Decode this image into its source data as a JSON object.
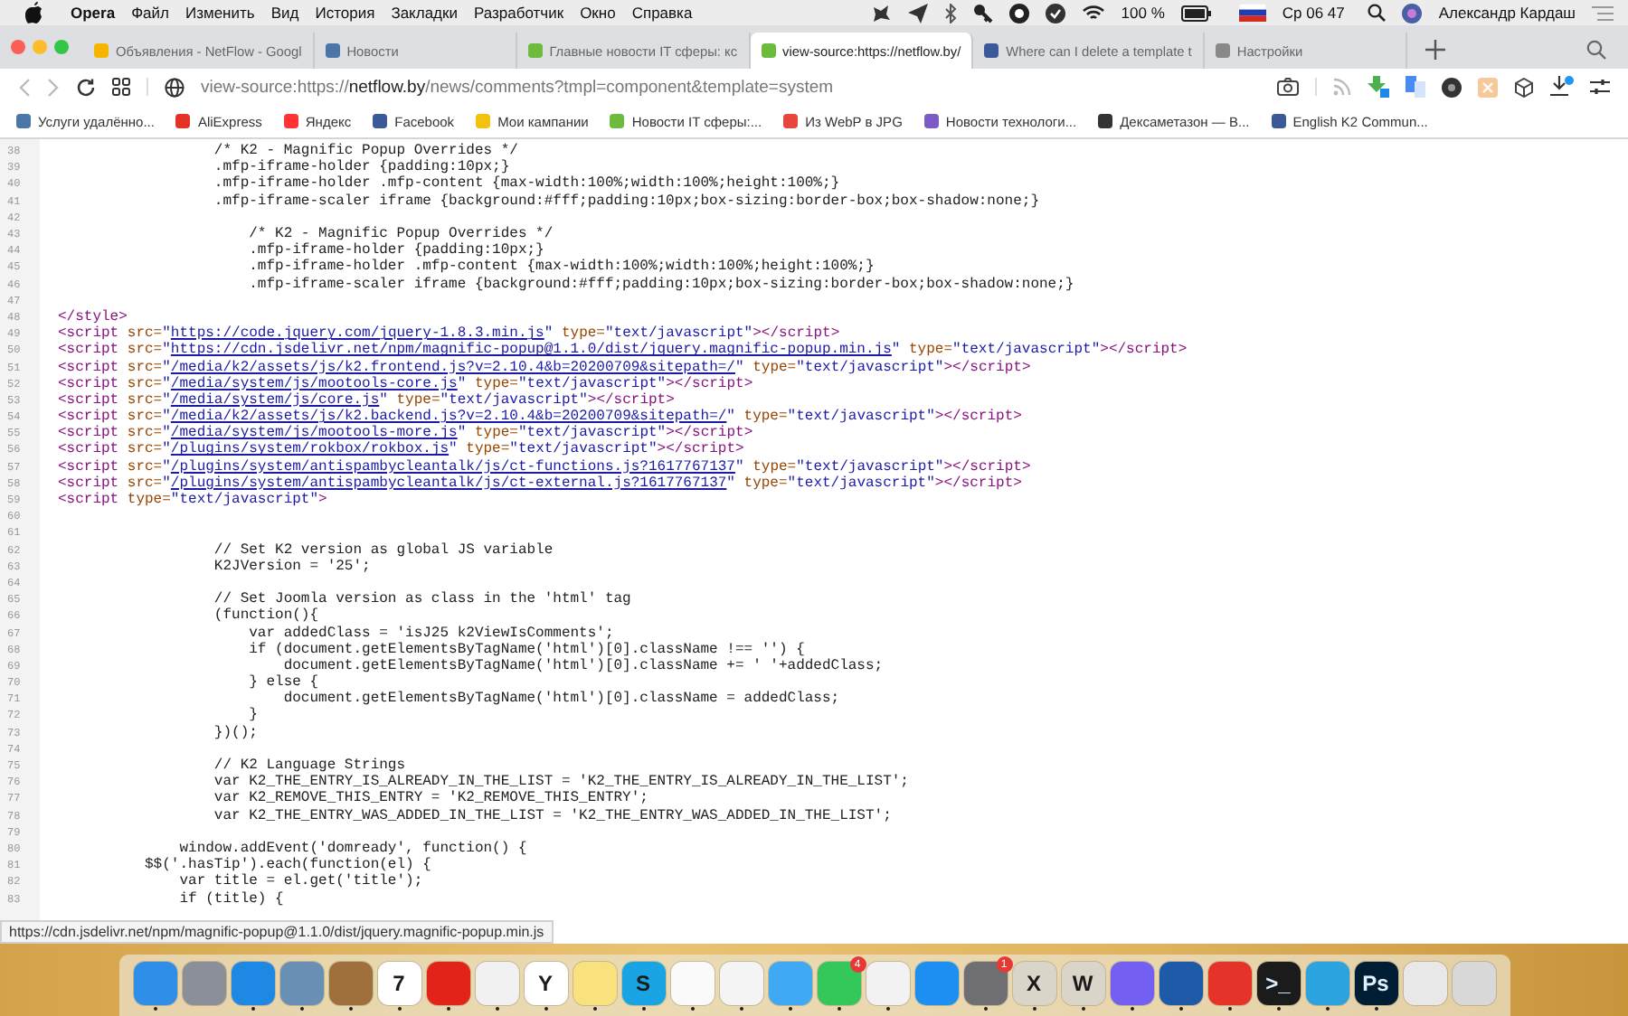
{
  "menu_bar": {
    "app": "Opera",
    "menus": [
      "Файл",
      "Изменить",
      "Вид",
      "История",
      "Закладки",
      "Разработчик",
      "Окно",
      "Справка"
    ],
    "battery": "100 %",
    "clock": "Ср 06 47",
    "user": "Александр Кардаш"
  },
  "tabs": [
    {
      "title": "Объявления - NetFlow - Googl",
      "selected": false,
      "color": "#f4b400"
    },
    {
      "title": "Новости",
      "selected": false,
      "color": "#4a76a8"
    },
    {
      "title": "Главные новости IT сферы: кс",
      "selected": false,
      "color": "#6cbb3c"
    },
    {
      "title": "view-source:https://netflow.by/",
      "selected": true,
      "color": "#6cbb3c"
    },
    {
      "title": "Where can I delete a template t",
      "selected": false,
      "color": "#3b5998"
    },
    {
      "title": "Настройки",
      "selected": false,
      "color": "#888888"
    }
  ],
  "address_bar": {
    "scheme": "view-source:https://",
    "host": "netflow.by",
    "path": "/news/comments?tmpl=component&template=system"
  },
  "bookmarks": [
    {
      "title": "Услуги удалённо...",
      "color": "#4a76a8"
    },
    {
      "title": "AliExpress",
      "color": "#e43225"
    },
    {
      "title": "Яндекс",
      "color": "#ff3333"
    },
    {
      "title": "Facebook",
      "color": "#3b5998"
    },
    {
      "title": "Мои кампании",
      "color": "#f4c20d"
    },
    {
      "title": "Новости IT сферы:...",
      "color": "#6cbb3c"
    },
    {
      "title": "Из WebP в JPG",
      "color": "#e8453c"
    },
    {
      "title": "Новости технологи...",
      "color": "#7b5cc4"
    },
    {
      "title": "Дексаметазон — В...",
      "color": "#333333"
    },
    {
      "title": "English K2 Commun...",
      "color": "#3b5998"
    }
  ],
  "source": {
    "lines": [
      {
        "num": "38",
        "segments": [
          {
            "kind": "plain",
            "text": "                  /* K2 - Magnific Popup Overrides */"
          }
        ]
      },
      {
        "num": "39",
        "segments": [
          {
            "kind": "plain",
            "text": "                  .mfp-iframe-holder {padding:10px;}"
          }
        ]
      },
      {
        "num": "40",
        "segments": [
          {
            "kind": "plain",
            "text": "                  .mfp-iframe-holder .mfp-content {max-width:100%;width:100%;height:100%;}"
          }
        ]
      },
      {
        "num": "41",
        "segments": [
          {
            "kind": "plain",
            "text": "                  .mfp-iframe-scaler iframe {background:#fff;padding:10px;box-sizing:border-box;box-shadow:none;}"
          }
        ]
      },
      {
        "num": "42"
      },
      {
        "num": "43",
        "segments": [
          {
            "kind": "plain",
            "text": "                      /* K2 - Magnific Popup Overrides */"
          }
        ]
      },
      {
        "num": "44",
        "segments": [
          {
            "kind": "plain",
            "text": "                      .mfp-iframe-holder {padding:10px;}"
          }
        ]
      },
      {
        "num": "45",
        "segments": [
          {
            "kind": "plain",
            "text": "                      .mfp-iframe-holder .mfp-content {max-width:100%;width:100%;height:100%;}"
          }
        ]
      },
      {
        "num": "46",
        "segments": [
          {
            "kind": "plain",
            "text": "                      .mfp-iframe-scaler iframe {background:#fff;padding:10px;box-sizing:border-box;box-shadow:none;}"
          }
        ]
      },
      {
        "num": "47"
      },
      {
        "num": "48",
        "segments": [
          {
            "kind": "tag",
            "text": "</style>"
          }
        ]
      },
      {
        "num": "49",
        "segments": [
          {
            "kind": "tag",
            "text": "<script "
          },
          {
            "kind": "attr",
            "text": "src="
          },
          {
            "kind": "value",
            "text": "\""
          },
          {
            "kind": "link",
            "text": "https://code.jquery.com/jquery-1.8.3.min.js"
          },
          {
            "kind": "value",
            "text": "\" "
          },
          {
            "kind": "attr",
            "text": "type="
          },
          {
            "kind": "value",
            "text": "\"text/javascript\""
          },
          {
            "kind": "tag",
            "text": "></script>"
          }
        ]
      },
      {
        "num": "50",
        "segments": [
          {
            "kind": "tag",
            "text": "<script "
          },
          {
            "kind": "attr",
            "text": "src="
          },
          {
            "kind": "value",
            "text": "\""
          },
          {
            "kind": "link",
            "text": "https://cdn.jsdelivr.net/npm/magnific-popup@1.1.0/dist/jquery.magnific-popup.min.js"
          },
          {
            "kind": "value",
            "text": "\" "
          },
          {
            "kind": "attr",
            "text": "type="
          },
          {
            "kind": "value",
            "text": "\"text/javascript\""
          },
          {
            "kind": "tag",
            "text": "></script>"
          }
        ]
      },
      {
        "num": "51",
        "segments": [
          {
            "kind": "tag",
            "text": "<script "
          },
          {
            "kind": "attr",
            "text": "src="
          },
          {
            "kind": "value",
            "text": "\""
          },
          {
            "kind": "link",
            "text": "/media/k2/assets/js/k2.frontend.js?v=2.10.4&b=20200709&sitepath=/"
          },
          {
            "kind": "value",
            "text": "\" "
          },
          {
            "kind": "attr",
            "text": "type="
          },
          {
            "kind": "value",
            "text": "\"text/javascript\""
          },
          {
            "kind": "tag",
            "text": "></script>"
          }
        ]
      },
      {
        "num": "52",
        "segments": [
          {
            "kind": "tag",
            "text": "<script "
          },
          {
            "kind": "attr",
            "text": "src="
          },
          {
            "kind": "value",
            "text": "\""
          },
          {
            "kind": "link",
            "text": "/media/system/js/mootools-core.js"
          },
          {
            "kind": "value",
            "text": "\" "
          },
          {
            "kind": "attr",
            "text": "type="
          },
          {
            "kind": "value",
            "text": "\"text/javascript\""
          },
          {
            "kind": "tag",
            "text": "></script>"
          }
        ]
      },
      {
        "num": "53",
        "segments": [
          {
            "kind": "tag",
            "text": "<script "
          },
          {
            "kind": "attr",
            "text": "src="
          },
          {
            "kind": "value",
            "text": "\""
          },
          {
            "kind": "link",
            "text": "/media/system/js/core.js"
          },
          {
            "kind": "value",
            "text": "\" "
          },
          {
            "kind": "attr",
            "text": "type="
          },
          {
            "kind": "value",
            "text": "\"text/javascript\""
          },
          {
            "kind": "tag",
            "text": "></script>"
          }
        ]
      },
      {
        "num": "54",
        "segments": [
          {
            "kind": "tag",
            "text": "<script "
          },
          {
            "kind": "attr",
            "text": "src="
          },
          {
            "kind": "value",
            "text": "\""
          },
          {
            "kind": "link",
            "text": "/media/k2/assets/js/k2.backend.js?v=2.10.4&b=20200709&sitepath=/"
          },
          {
            "kind": "value",
            "text": "\" "
          },
          {
            "kind": "attr",
            "text": "type="
          },
          {
            "kind": "value",
            "text": "\"text/javascript\""
          },
          {
            "kind": "tag",
            "text": "></script>"
          }
        ]
      },
      {
        "num": "55",
        "segments": [
          {
            "kind": "tag",
            "text": "<script "
          },
          {
            "kind": "attr",
            "text": "src="
          },
          {
            "kind": "value",
            "text": "\""
          },
          {
            "kind": "link",
            "text": "/media/system/js/mootools-more.js"
          },
          {
            "kind": "value",
            "text": "\" "
          },
          {
            "kind": "attr",
            "text": "type="
          },
          {
            "kind": "value",
            "text": "\"text/javascript\""
          },
          {
            "kind": "tag",
            "text": "></script>"
          }
        ]
      },
      {
        "num": "56",
        "segments": [
          {
            "kind": "tag",
            "text": "<script "
          },
          {
            "kind": "attr",
            "text": "src="
          },
          {
            "kind": "value",
            "text": "\""
          },
          {
            "kind": "link",
            "text": "/plugins/system/rokbox/rokbox.js"
          },
          {
            "kind": "value",
            "text": "\" "
          },
          {
            "kind": "attr",
            "text": "type="
          },
          {
            "kind": "value",
            "text": "\"text/javascript\""
          },
          {
            "kind": "tag",
            "text": "></script>"
          }
        ]
      },
      {
        "num": "57",
        "segments": [
          {
            "kind": "tag",
            "text": "<script "
          },
          {
            "kind": "attr",
            "text": "src="
          },
          {
            "kind": "value",
            "text": "\""
          },
          {
            "kind": "link",
            "text": "/plugins/system/antispambycleantalk/js/ct-functions.js?1617767137"
          },
          {
            "kind": "value",
            "text": "\" "
          },
          {
            "kind": "attr",
            "text": "type="
          },
          {
            "kind": "value",
            "text": "\"text/javascript\""
          },
          {
            "kind": "tag",
            "text": "></script>"
          }
        ]
      },
      {
        "num": "58",
        "segments": [
          {
            "kind": "tag",
            "text": "<script "
          },
          {
            "kind": "attr",
            "text": "src="
          },
          {
            "kind": "value",
            "text": "\""
          },
          {
            "kind": "link",
            "text": "/plugins/system/antispambycleantalk/js/ct-external.js?1617767137"
          },
          {
            "kind": "value",
            "text": "\" "
          },
          {
            "kind": "attr",
            "text": "type="
          },
          {
            "kind": "value",
            "text": "\"text/javascript\""
          },
          {
            "kind": "tag",
            "text": "></script>"
          }
        ]
      },
      {
        "num": "59",
        "segments": [
          {
            "kind": "tag",
            "text": "<script "
          },
          {
            "kind": "attr",
            "text": "type="
          },
          {
            "kind": "value",
            "text": "\"text/javascript\""
          },
          {
            "kind": "tag",
            "text": ">"
          }
        ]
      },
      {
        "num": "60"
      },
      {
        "num": "61"
      },
      {
        "num": "62",
        "segments": [
          {
            "kind": "plain",
            "text": "                  // Set K2 version as global JS variable"
          }
        ]
      },
      {
        "num": "63",
        "segments": [
          {
            "kind": "plain",
            "text": "                  K2JVersion = '25';"
          }
        ]
      },
      {
        "num": "64"
      },
      {
        "num": "65",
        "segments": [
          {
            "kind": "plain",
            "text": "                  // Set Joomla version as class in the 'html' tag"
          }
        ]
      },
      {
        "num": "66",
        "segments": [
          {
            "kind": "plain",
            "text": "                  (function(){"
          }
        ]
      },
      {
        "num": "67",
        "segments": [
          {
            "kind": "plain",
            "text": "                      var addedClass = 'isJ25 k2ViewIsComments';"
          }
        ]
      },
      {
        "num": "68",
        "segments": [
          {
            "kind": "plain",
            "text": "                      if (document.getElementsByTagName('html')[0].className !== '') {"
          }
        ]
      },
      {
        "num": "69",
        "segments": [
          {
            "kind": "plain",
            "text": "                          document.getElementsByTagName('html')[0].className += ' '+addedClass;"
          }
        ]
      },
      {
        "num": "70",
        "segments": [
          {
            "kind": "plain",
            "text": "                      } else {"
          }
        ]
      },
      {
        "num": "71",
        "segments": [
          {
            "kind": "plain",
            "text": "                          document.getElementsByTagName('html')[0].className = addedClass;"
          }
        ]
      },
      {
        "num": "72",
        "segments": [
          {
            "kind": "plain",
            "text": "                      }"
          }
        ]
      },
      {
        "num": "73",
        "segments": [
          {
            "kind": "plain",
            "text": "                  })();"
          }
        ]
      },
      {
        "num": "74"
      },
      {
        "num": "75",
        "segments": [
          {
            "kind": "plain",
            "text": "                  // K2 Language Strings"
          }
        ]
      },
      {
        "num": "76",
        "segments": [
          {
            "kind": "plain",
            "text": "                  var K2_THE_ENTRY_IS_ALREADY_IN_THE_LIST = 'K2_THE_ENTRY_IS_ALREADY_IN_THE_LIST';"
          }
        ]
      },
      {
        "num": "77",
        "segments": [
          {
            "kind": "plain",
            "text": "                  var K2_REMOVE_THIS_ENTRY = 'K2_REMOVE_THIS_ENTRY';"
          }
        ]
      },
      {
        "num": "78",
        "segments": [
          {
            "kind": "plain",
            "text": "                  var K2_THE_ENTRY_WAS_ADDED_IN_THE_LIST = 'K2_THE_ENTRY_WAS_ADDED_IN_THE_LIST';"
          }
        ]
      },
      {
        "num": "79"
      },
      {
        "num": "80",
        "segments": [
          {
            "kind": "plain",
            "text": "              window.addEvent('domready', function() {"
          }
        ]
      },
      {
        "num": "81",
        "segments": [
          {
            "kind": "plain",
            "text": "          $$('.hasTip').each(function(el) {"
          }
        ]
      },
      {
        "num": "82",
        "segments": [
          {
            "kind": "plain",
            "text": "              var title = el.get('title');"
          }
        ]
      },
      {
        "num": "83",
        "segments": [
          {
            "kind": "plain",
            "text": "              if (title) {"
          }
        ]
      }
    ]
  },
  "status_tooltip": "https://cdn.jsdelivr.net/npm/magnific-popup@1.1.0/dist/jquery.magnific-popup.min.js",
  "dock": {
    "items": [
      {
        "color": "#2f8ee8",
        "running": true
      },
      {
        "color": "#8a8f99",
        "running": false
      },
      {
        "color": "#1e88e5",
        "running": true
      },
      {
        "color": "#6a8fb5",
        "running": true
      },
      {
        "color": "#a0703c",
        "running": true
      },
      {
        "color": "#ffffff",
        "glyph": "7",
        "running": true
      },
      {
        "color": "#e2231a",
        "running": true
      },
      {
        "color": "#f1f1f1",
        "running": true
      },
      {
        "color": "#ffffff",
        "glyph": "Y",
        "running": true
      },
      {
        "color": "#f9e27d",
        "running": true
      },
      {
        "color": "#19a5e4",
        "glyph": "S",
        "running": true
      },
      {
        "color": "#fafafa",
        "running": true
      },
      {
        "color": "#f4f4f4",
        "running": true
      },
      {
        "color": "#3fa9f5",
        "running": true
      },
      {
        "color": "#34c759",
        "badge": "4",
        "running": true
      },
      {
        "color": "#f2f2f2",
        "running": true
      },
      {
        "color": "#1d8ff2",
        "running": false
      },
      {
        "color": "#6e6e73",
        "badge": "1",
        "running": true
      },
      {
        "color": "#d9d5c8",
        "glyph": "X",
        "running": true
      },
      {
        "color": "#d9d5c8",
        "glyph": "W",
        "running": true
      },
      {
        "color": "#7360f2",
        "running": true
      },
      {
        "color": "#1e5aa8",
        "running": true
      },
      {
        "color": "#e5332a",
        "running": true
      },
      {
        "color": "#1b1b1b",
        "glyph": ">_",
        "running": true
      },
      {
        "color": "#2aa3df",
        "running": true
      },
      {
        "color": "#001d34",
        "glyph": "Ps",
        "running": true
      },
      {
        "color": "#e8e8e8",
        "running": false
      },
      {
        "color": "#d8d8d8",
        "running": false
      }
    ]
  }
}
